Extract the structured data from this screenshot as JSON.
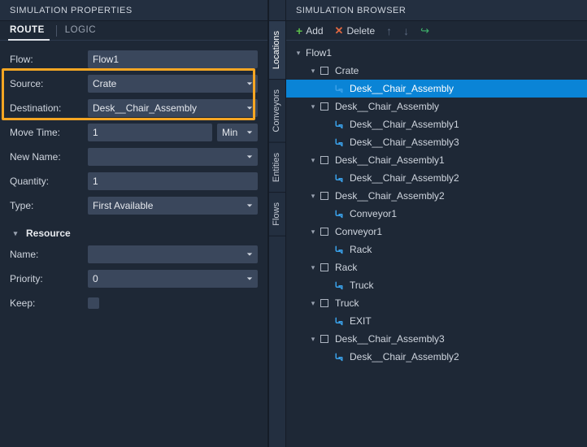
{
  "panels": {
    "properties_title": "SIMULATION PROPERTIES",
    "browser_title": "SIMULATION BROWSER"
  },
  "tabs": {
    "route": "ROUTE",
    "logic": "LOGIC"
  },
  "fields": {
    "flow_label": "Flow:",
    "flow_value": "Flow1",
    "source_label": "Source:",
    "source_value": "Crate",
    "destination_label": "Destination:",
    "destination_value": "Desk__Chair_Assembly",
    "movetime_label": "Move Time:",
    "movetime_value": "1",
    "movetime_unit": "Min",
    "newname_label": "New Name:",
    "newname_value": "",
    "quantity_label": "Quantity:",
    "quantity_value": "1",
    "type_label": "Type:",
    "type_value": "First Available",
    "resource_header": "Resource",
    "name_label": "Name:",
    "name_value": "",
    "priority_label": "Priority:",
    "priority_value": "0",
    "keep_label": "Keep:"
  },
  "toolbar": {
    "add": "Add",
    "delete": "Delete"
  },
  "side_tabs": {
    "locations": "Locations",
    "conveyors": "Conveyors",
    "entities": "Entities",
    "flows": "Flows"
  },
  "tree": [
    {
      "depth": 0,
      "expand": true,
      "icon": "none",
      "label": "Flow1"
    },
    {
      "depth": 1,
      "expand": true,
      "icon": "sq",
      "label": "Crate"
    },
    {
      "depth": 2,
      "expand": false,
      "icon": "arrow",
      "label": "Desk__Chair_Assembly",
      "selected": true
    },
    {
      "depth": 1,
      "expand": true,
      "icon": "sq",
      "label": "Desk__Chair_Assembly"
    },
    {
      "depth": 2,
      "expand": false,
      "icon": "arrow",
      "label": "Desk__Chair_Assembly1"
    },
    {
      "depth": 2,
      "expand": false,
      "icon": "arrow",
      "label": "Desk__Chair_Assembly3"
    },
    {
      "depth": 1,
      "expand": true,
      "icon": "sq",
      "label": "Desk__Chair_Assembly1"
    },
    {
      "depth": 2,
      "expand": false,
      "icon": "arrow",
      "label": "Desk__Chair_Assembly2"
    },
    {
      "depth": 1,
      "expand": true,
      "icon": "sq",
      "label": "Desk__Chair_Assembly2"
    },
    {
      "depth": 2,
      "expand": false,
      "icon": "arrow",
      "label": "Conveyor1"
    },
    {
      "depth": 1,
      "expand": true,
      "icon": "sq",
      "label": "Conveyor1"
    },
    {
      "depth": 2,
      "expand": false,
      "icon": "arrow",
      "label": "Rack"
    },
    {
      "depth": 1,
      "expand": true,
      "icon": "sq",
      "label": "Rack"
    },
    {
      "depth": 2,
      "expand": false,
      "icon": "arrow",
      "label": "Truck"
    },
    {
      "depth": 1,
      "expand": true,
      "icon": "sq",
      "label": "Truck"
    },
    {
      "depth": 2,
      "expand": false,
      "icon": "arrow",
      "label": "EXIT"
    },
    {
      "depth": 1,
      "expand": true,
      "icon": "sq",
      "label": "Desk__Chair_Assembly3"
    },
    {
      "depth": 2,
      "expand": false,
      "icon": "arrow",
      "label": "Desk__Chair_Assembly2"
    }
  ],
  "colors": {
    "highlight": "#f5a623",
    "selection": "#0a84d6"
  }
}
